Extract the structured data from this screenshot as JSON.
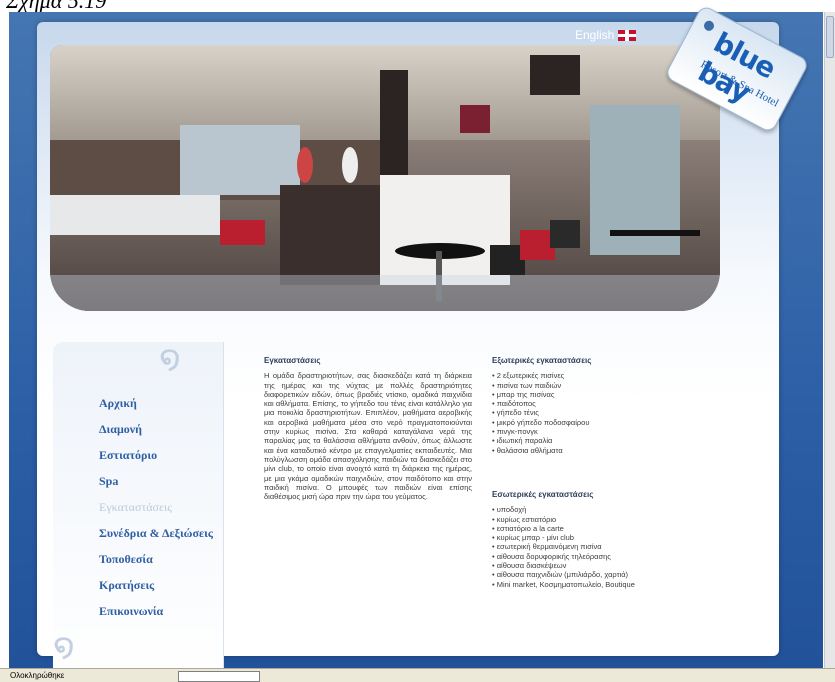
{
  "caption": "Σχήμα 5.19",
  "header": {
    "language_label": "English"
  },
  "logo": {
    "word": "blue bay",
    "subtitle": "Resort & Spa Hotel"
  },
  "menu": [
    {
      "label": "Αρχική"
    },
    {
      "label": "Διαμονή"
    },
    {
      "label": "Εστιατόριο"
    },
    {
      "label": "Spa"
    },
    {
      "label": "Εγκαταστάσεις",
      "active": true
    },
    {
      "label": "Συνέδρια & Δεξιώσεις"
    },
    {
      "label": "Τοποθεσία"
    },
    {
      "label": "Κρατήσεις"
    },
    {
      "label": "Επικοινωνία"
    }
  ],
  "content": {
    "title": "Εγκαταστάσεις",
    "body": "Η ομάδα δραστηριοτήτων, σας διασκεδάζει κατά τη διάρκεια της ημέρας και της νύχτας με πολλές δραστηριότητες διαφορετικών ειδών, όπως βραδιές ντίσκο, ομαδικά παιχνίδια και αθλήματα. Επίσης, το γήπεδο του τένις είναι κατάλληλο για μια ποικιλία δραστηριοτήτων. Επιπλέον, μαθήματα αεροβικής και αεροβικά μαθήματα μέσα στο νερό πραγματοποιούνται στην κυρίως πισίνα. Στα καθαρά καταγάλανα νερά της παραλίας μας τα θαλάσσια αθλήματα ανθούν, όπως άλλωστε και ένα καταδυτικό κέντρο με επαγγελματίες εκπαιδευτές. Μια πολύγλωσση ομάδα απασχόλησης παιδιών τα διασκεδάζει στο μίνι club, το οποίο είναι ανοιχτό κατά τη διάρκεια της ημέρας, με μια γκάμα ομαδικών παιχνιδιών, στον παιδότοπο και στην παιδική πισίνα. Ο μπουφές των παιδιών είναι επίσης διαθέσιμος μισή ώρα πριν την ώρα του γεύματος."
  },
  "external": {
    "title": "Εξωτερικές εγκαταστάσεις",
    "items": [
      "• 2 εξωτερικές πισίνες",
      "• πισίνα των παιδιών",
      "• μπαρ της πισίνας",
      "• παιδότοπος",
      "• γήπεδο τένις",
      "• μικρό γήπεδο ποδοσφαίρου",
      "• πινγκ-πονγκ",
      "• ιδιωτική παραλία",
      "• θαλάσσια αθλήματα"
    ]
  },
  "internal": {
    "title": "Εσωτερικές εγκαταστάσεις",
    "items": [
      "• υποδοχή",
      "• κυρίως εστιατόριο",
      "• εστιατόριο a la carte",
      "• κυρίως μπαρ - μίνι club",
      "• εσωτερική θερμαινόμενη πισίνα",
      "• αίθουσα δορυφορικής τηλεόρασης",
      "• αίθουσα διασκέψεων",
      "• αίθουσα παιχνιδιών (μπιλιάρδο, χαρτιά)",
      "• Mini market, Κοσμηματοπωλείο, Boutique"
    ]
  },
  "status": {
    "text": "Ολοκληρώθηκε"
  },
  "colors": {
    "accent": "#2e5fa4",
    "background": "#2c5fa6"
  }
}
